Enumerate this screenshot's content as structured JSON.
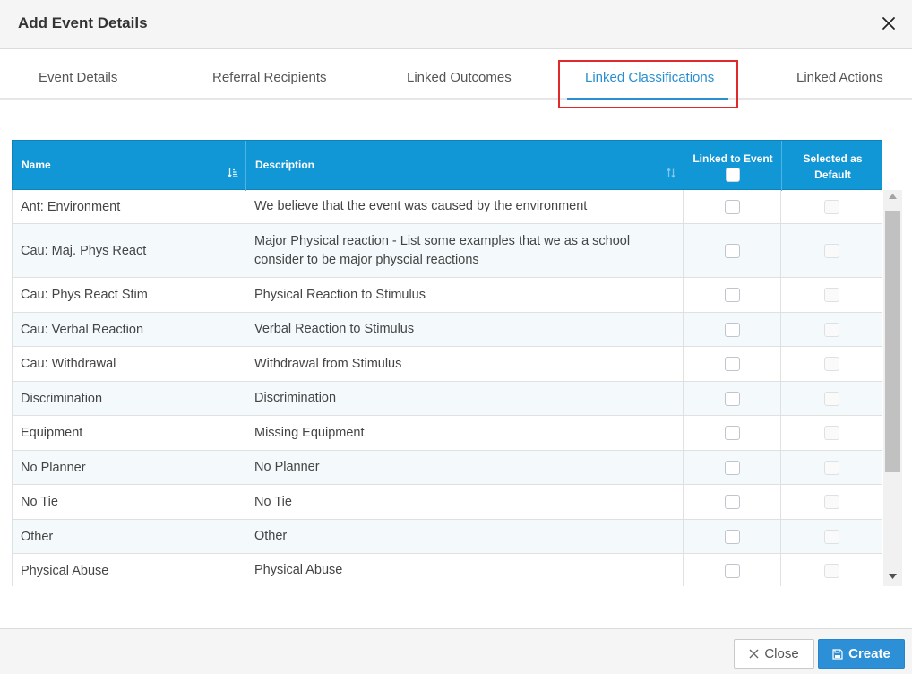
{
  "dialog": {
    "title": "Add Event Details"
  },
  "tabs": [
    {
      "label": "Event Details"
    },
    {
      "label": "Referral Recipients"
    },
    {
      "label": "Linked Outcomes"
    },
    {
      "label": "Linked Classifications"
    },
    {
      "label": "Linked Actions"
    }
  ],
  "active_tab": "Linked Classifications",
  "table": {
    "headers": {
      "name": "Name",
      "description": "Description",
      "linked": "Linked to Event",
      "default_line1": "Selected as",
      "default_line2": "Default"
    },
    "rows": [
      {
        "name": "Ant: Environment",
        "description": "We believe that the event was caused by the environment",
        "linked": false,
        "default": false
      },
      {
        "name": "Cau: Maj. Phys React",
        "description": "Major Physical reaction - List some examples that we as a school consider to be major physcial reactions",
        "linked": false,
        "default": false
      },
      {
        "name": "Cau: Phys React Stim",
        "description": "Physical Reaction to Stimulus",
        "linked": false,
        "default": false
      },
      {
        "name": "Cau: Verbal Reaction",
        "description": "Verbal Reaction to Stimulus",
        "linked": false,
        "default": false
      },
      {
        "name": "Cau: Withdrawal",
        "description": "Withdrawal from Stimulus",
        "linked": false,
        "default": false
      },
      {
        "name": "Discrimination",
        "description": "Discrimination",
        "linked": false,
        "default": false
      },
      {
        "name": "Equipment",
        "description": "Missing Equipment",
        "linked": false,
        "default": false
      },
      {
        "name": "No Planner",
        "description": "No Planner",
        "linked": false,
        "default": false
      },
      {
        "name": "No Tie",
        "description": "No Tie",
        "linked": false,
        "default": false
      },
      {
        "name": "Other",
        "description": "Other",
        "linked": false,
        "default": false
      },
      {
        "name": "Physical Abuse",
        "description": "Physical Abuse",
        "linked": false,
        "default": false
      }
    ]
  },
  "footer": {
    "close_label": "Close",
    "create_label": "Create"
  },
  "colors": {
    "accent": "#2a8fd0",
    "header_bg": "#1196d6",
    "highlight": "#e02a2a"
  }
}
